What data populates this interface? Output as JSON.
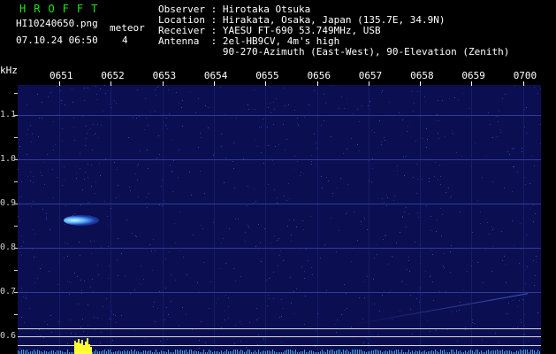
{
  "header": {
    "station": "HROFFT",
    "filename": "HI10240650.png",
    "datetime": "07.10.24 06:50",
    "meteor_label": "meteor",
    "meteor_count": "4"
  },
  "info": {
    "observer": "Observer : Hirotaka Otsuka",
    "location": "Location : Hirakata, Osaka, Japan (135.7E, 34.9N)",
    "receiver": "Receiver : YAESU FT-690 53.749MHz, USB",
    "antenna": "Antenna  : 2el-HB9CV, 4m's high",
    "antenna2": "           90-270-Azimuth (East-West), 90-Elevation (Zenith)"
  },
  "axis": {
    "unit": "kHz",
    "y_ticks": [
      "1.1",
      "1.0",
      "0.9",
      "0.8",
      "0.7",
      "0.6"
    ],
    "x_ticks": [
      "0651",
      "0652",
      "0653",
      "0654",
      "0655",
      "0656",
      "0657",
      "0658",
      "0659",
      "0700"
    ]
  },
  "colors": {
    "background": "#000000",
    "plot": "#0b0f52",
    "title_green": "#21e321",
    "signal": "#6fd0ff",
    "bars": "#ffff33",
    "floor": "#3fa0d8"
  }
}
